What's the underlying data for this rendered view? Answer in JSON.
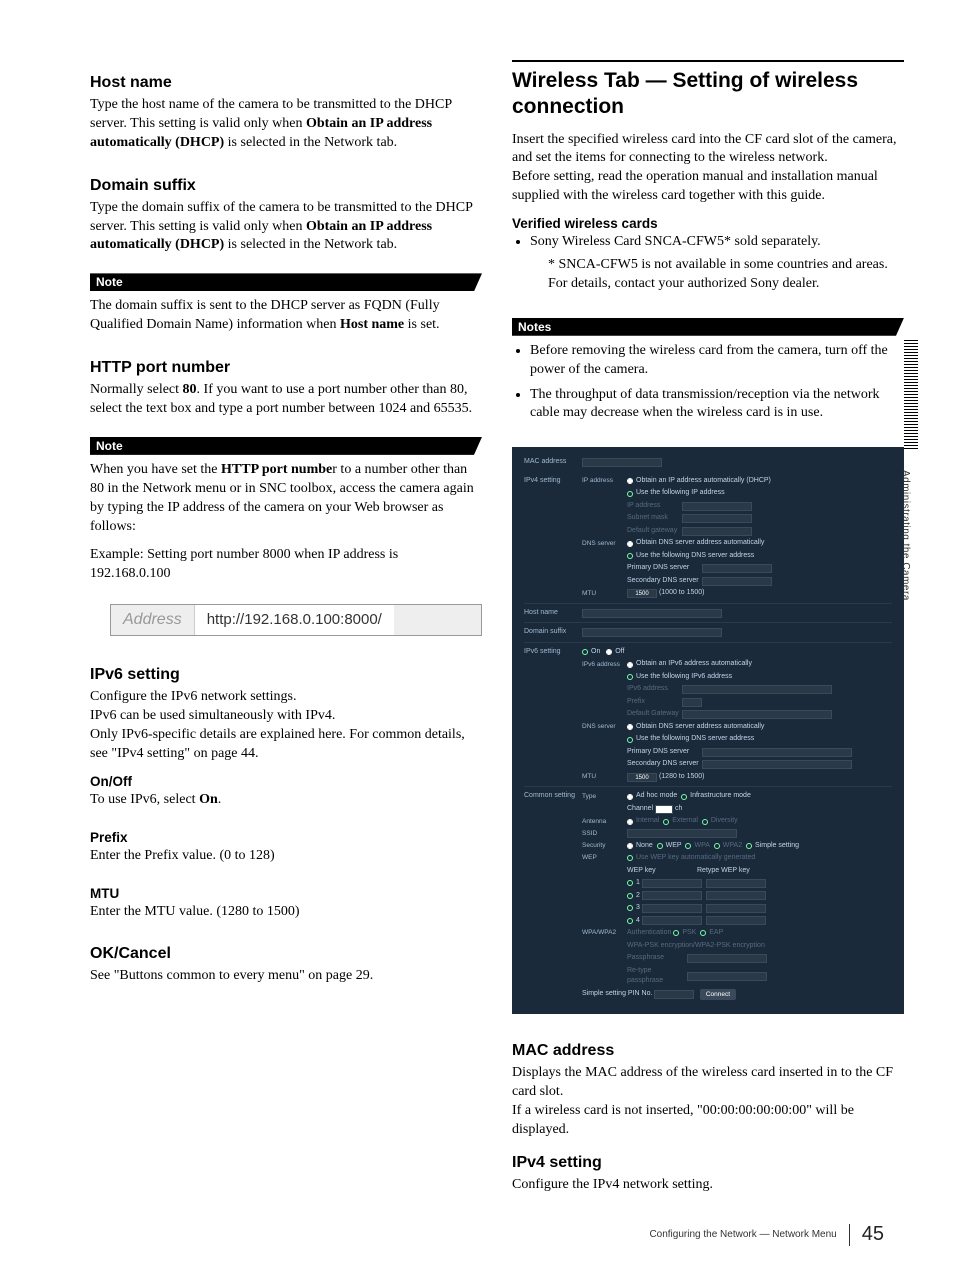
{
  "left": {
    "host_name": {
      "heading": "Host name",
      "body_pre": "Type the host name of the camera to be transmitted to the DHCP server. This setting is valid only when ",
      "body_bold": "Obtain an IP address automatically (DHCP)",
      "body_post": " is selected in the Network tab."
    },
    "domain_suffix": {
      "heading": "Domain suffix",
      "body_pre": "Type the domain suffix of the camera to be transmitted to the DHCP server. This setting is valid only when ",
      "body_bold": "Obtain an IP address automatically (DHCP)",
      "body_post": " is selected in the Network tab.",
      "note_label": "Note",
      "note_pre": "The domain suffix is sent to the DHCP server as FQDN (Fully Qualified Domain Name) information when ",
      "note_bold": "Host name",
      "note_post": " is set."
    },
    "http_port": {
      "heading": "HTTP port number",
      "body_pre": "Normally select ",
      "body_bold": "80",
      "body_post": ". If you want to use a port number other than 80, select the text box and type a port number between 1024 and 65535.",
      "note_label": "Note",
      "note_pre": "When you have set the ",
      "note_bold": "HTTP port numbe",
      "note_post": "r to a number other than 80 in the Network menu or in SNC toolbox, access the camera again by typing the IP address of the camera on your Web browser as follows:",
      "example": "Example: Setting port number 8000 when IP address is 192.168.0.100",
      "addr_label": "Address",
      "addr_url": "http://192.168.0.100:8000/"
    },
    "ipv6": {
      "heading": "IPv6 setting",
      "line1": "Configure the IPv6 network settings.",
      "line2": "IPv6 can be used simultaneously with IPv4.",
      "line3": "Only IPv6-specific details are explained here. For common details, see \"IPv4 setting\" on page 44.",
      "onoff_h": "On/Off",
      "onoff_pre": "To use IPv6, select ",
      "onoff_bold": "On",
      "onoff_post": ".",
      "prefix_h": "Prefix",
      "prefix_body": "Enter the Prefix value. (0 to 128)",
      "mtu_h": "MTU",
      "mtu_body": "Enter the MTU value. (1280 to 1500)"
    },
    "ok_cancel": {
      "heading": "OK/Cancel",
      "body": "See \"Buttons common to every menu\" on page 29."
    }
  },
  "right": {
    "title": "Wireless Tab — Setting of wireless connection",
    "intro1": "Insert the specified wireless card into the CF card slot of the camera, and set the items for connecting to the wireless network.",
    "intro2": "Before setting, read the operation manual and installation manual supplied with the wireless card together with this guide.",
    "verified_h": "Verified wireless cards",
    "verified_bullet": "Sony Wireless Card SNCA-CFW5* sold separately.",
    "verified_note": "* SNCA-CFW5 is not available in some countries and areas. For details, contact your authorized Sony dealer.",
    "notes_label": "Notes",
    "notes": [
      "Before removing the wireless card from the camera, turn off the power of the camera.",
      "The throughput of data transmission/reception via the network cable may decrease when the wireless card is in use."
    ],
    "form": {
      "mac_label": "MAC address",
      "ipv4_setting": "IPv4 setting",
      "ip_address": "IP address",
      "dhcp": "Obtain an IP address automatically (DHCP)",
      "use_ip": "Use the following IP address",
      "ip_addr_lbl": "IP address",
      "subnet": "Subnet mask",
      "gateway": "Default gateway",
      "dns_server": "DNS server",
      "dns_auto": "Obtain DNS server address automatically",
      "dns_manual": "Use the following DNS server address",
      "pri_dns": "Primary DNS server",
      "sec_dns": "Secondary DNS server",
      "mtu": "MTU",
      "mtu_val": "1500",
      "mtu_range": "(1000 to 1500)",
      "host_name": "Host name",
      "domain_suffix": "Domain suffix",
      "ipv6_setting": "IPv6 setting",
      "on": "On",
      "off": "Off",
      "ipv6_address": "IPv6 address",
      "ipv6_auto": "Obtain an IPv6 address automatically",
      "ipv6_manual": "Use the following IPv6 address",
      "ipv6_addr_lbl": "IPv6 address",
      "prefix": "Prefix",
      "def_gw": "Default Gateway",
      "ipv6_mtu_val": "1500",
      "ipv6_mtu_range": "(1280 to 1500)",
      "common_setting": "Common setting",
      "type": "Type",
      "adhoc": "Ad hoc mode",
      "infra": "Infrastructure mode",
      "channel": "Channel",
      "channel_suffix": "ch",
      "antenna": "Antenna",
      "internal": "Internal",
      "external": "External",
      "diversity": "Diversity",
      "ssid": "SSID",
      "security": "Security",
      "sec_none": "None",
      "sec_wep": "WEP",
      "sec_wpa": "WPA",
      "sec_wpa2": "WPA2",
      "sec_simple": "Simple setting",
      "wep": "WEP",
      "wep_auto": "Use WEP key automatically generated",
      "wep_key": "WEP key",
      "retype_wep": "Retype WEP key",
      "k1": "1",
      "k2": "2",
      "k3": "3",
      "k4": "4",
      "wpa": "WPA/WPA2",
      "auth": "Authentication",
      "psk": "PSK",
      "eap": "EAP",
      "wpa_enc": "WPA-PSK encryption/WPA2-PSK encryption",
      "passphrase": "Passphrase",
      "retype_pass": "Re-type passphrase",
      "simple_pin": "Simple setting PIN No.",
      "connect": "Connect"
    },
    "mac": {
      "heading": "MAC address",
      "line1": "Displays the MAC address of the wireless card inserted in to the CF card slot.",
      "line2": "If a wireless card is not inserted, \"00:00:00:00:00:00\" will be displayed."
    },
    "ipv4": {
      "heading": "IPv4 setting",
      "body": "Configure the IPv4 network setting."
    }
  },
  "side_tab": "Administrating the Camera",
  "footer": {
    "text": "Configuring the Network — Network Menu",
    "page": "45"
  }
}
